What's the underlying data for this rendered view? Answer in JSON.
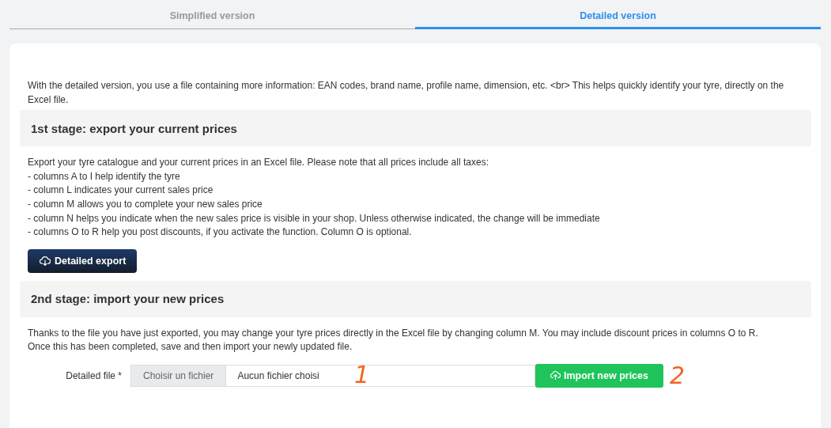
{
  "tabs": [
    {
      "label": "Simplified version",
      "selected": false
    },
    {
      "label": "Detailed version",
      "selected": true
    }
  ],
  "intro": "With the detailed version, you use a file containing more information: EAN codes, brand name, profile name, dimension, etc. <br> This helps quickly identify your tyre, directly on the Excel file.",
  "stage1": {
    "title": "1st stage: export your current prices",
    "lines": [
      "Export your tyre catalogue and your current prices in an Excel file. Please note that all prices include all taxes:",
      "- columns A to I help identify the tyre",
      "- column L indicates your current sales price",
      "- column M allows you to complete your new sales price",
      "- column N helps you indicate when the new sales price is visible in your shop. Unless otherwise indicated, the change will be immediate",
      "- columns O to R help you post discounts, if you activate the function. Column O is optional."
    ],
    "button": "Detailed export"
  },
  "stage2": {
    "title": "2nd stage: import your new prices",
    "lines": [
      "Thanks to the file you have just exported, you may change your tyre prices directly in the Excel file by changing column M. You may include discount prices in columns O to R.",
      "Once this has been completed, save and then import your newly updated file."
    ],
    "file_label": "Detailed file",
    "required_mark": "*",
    "choose_button": "Choisir un fichier",
    "file_status": "Aucun fichier choisi",
    "button": "Import new prices"
  },
  "annotations": [
    {
      "text": "1",
      "color": "#f26522"
    },
    {
      "text": "2",
      "color": "#f26522"
    }
  ]
}
